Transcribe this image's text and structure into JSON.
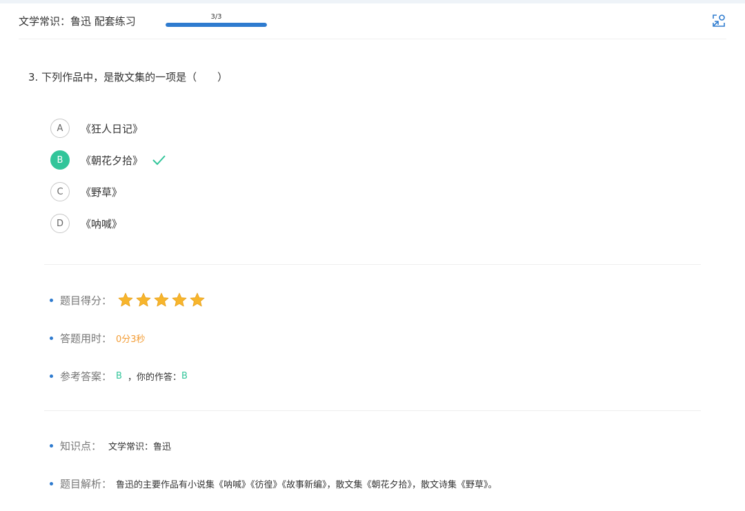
{
  "header": {
    "title": "文学常识：鲁迅 配套练习",
    "progress_text": "3/3",
    "progress_fraction": 1.0,
    "expand_icon": "expand-icon"
  },
  "question": {
    "text": "3.  下列作品中，是散文集的一项是（　　）"
  },
  "options": [
    {
      "letter": "A",
      "text": "《狂人日记》",
      "selected": false
    },
    {
      "letter": "B",
      "text": "《朝花夕拾》",
      "selected": true
    },
    {
      "letter": "C",
      "text": "《野草》",
      "selected": false
    },
    {
      "letter": "D",
      "text": "《呐喊》",
      "selected": false
    }
  ],
  "result": {
    "score_label": "题目得分：",
    "stars": 5,
    "time_label": "答题用时：",
    "time_value": "0分3秒",
    "answer_label": "参考答案：",
    "answer_value": "B",
    "your_answer_label": "，你的作答：",
    "your_answer_value": "B"
  },
  "knowledge": {
    "point_label": "知识点：",
    "point_value": "文学常识：鲁迅",
    "analysis_label": "题目解析：",
    "analysis_value": "鲁迅的主要作品有小说集《呐喊》《彷徨》《故事新编》，散文集《朝花夕拾》，散文诗集《野草》。"
  },
  "colors": {
    "accent": "#2e7bcf",
    "correct": "#32c59a",
    "time": "#f39c34",
    "star": "#f7b52c"
  }
}
